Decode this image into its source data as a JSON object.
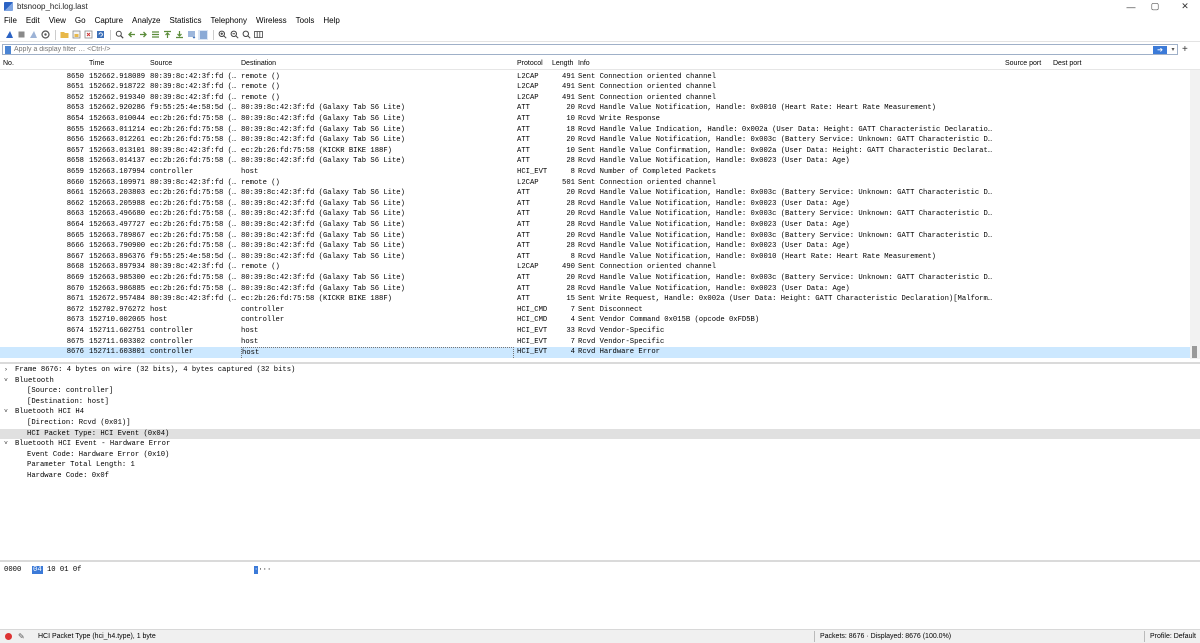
{
  "window": {
    "title": "btsnoop_hci.log.last",
    "minimize": "—",
    "maximize": "▢",
    "close": "✕"
  },
  "menu": [
    "File",
    "Edit",
    "View",
    "Go",
    "Capture",
    "Analyze",
    "Statistics",
    "Telephony",
    "Wireless",
    "Tools",
    "Help"
  ],
  "toolbar_icons": [
    "shark-fin-start-icon",
    "stop-icon",
    "restart-icon",
    "capture-options-icon",
    "open-file-icon",
    "save-file-icon",
    "close-file-icon",
    "reload-icon",
    "find-packet-icon",
    "go-back-icon",
    "go-forward-icon",
    "go-to-packet-icon",
    "go-first-icon",
    "go-last-icon",
    "auto-scroll-icon",
    "colorize-icon",
    "zoom-in-icon",
    "zoom-out-icon",
    "zoom-normal-icon",
    "resize-columns-icon"
  ],
  "filter": {
    "placeholder": "Apply a display filter … <Ctrl-/>",
    "apply_symbol": "➔",
    "dropdown_symbol": "▾",
    "add_symbol": "+"
  },
  "packet_list": {
    "columns": [
      "No.",
      "Time",
      "Source",
      "Destination",
      "Protocol",
      "Length",
      "Info",
      "Source port",
      "Dest port"
    ],
    "rows": [
      {
        "no": "8650",
        "time": "152662.918089",
        "src": "80:39:8c:42:3f:fd (…",
        "dst": "remote ()",
        "proto": "L2CAP",
        "len": "491",
        "info": "Sent Connection oriented channel"
      },
      {
        "no": "8651",
        "time": "152662.918722",
        "src": "80:39:8c:42:3f:fd (…",
        "dst": "remote ()",
        "proto": "L2CAP",
        "len": "491",
        "info": "Sent Connection oriented channel"
      },
      {
        "no": "8652",
        "time": "152662.919340",
        "src": "80:39:8c:42:3f:fd (…",
        "dst": "remote ()",
        "proto": "L2CAP",
        "len": "491",
        "info": "Sent Connection oriented channel"
      },
      {
        "no": "8653",
        "time": "152662.920286",
        "src": "f9:55:25:4e:58:5d (…",
        "dst": "80:39:8c:42:3f:fd (Galaxy Tab S6 Lite)",
        "proto": "ATT",
        "len": "20",
        "info": "Rcvd Handle Value Notification, Handle: 0x0010 (Heart Rate: Heart Rate Measurement)"
      },
      {
        "no": "8654",
        "time": "152663.010044",
        "src": "ec:2b:26:fd:75:58 (…",
        "dst": "80:39:8c:42:3f:fd (Galaxy Tab S6 Lite)",
        "proto": "ATT",
        "len": "10",
        "info": "Rcvd Write Response"
      },
      {
        "no": "8655",
        "time": "152663.011214",
        "src": "ec:2b:26:fd:75:58 (…",
        "dst": "80:39:8c:42:3f:fd (Galaxy Tab S6 Lite)",
        "proto": "ATT",
        "len": "18",
        "info": "Rcvd Handle Value Indication, Handle: 0x002a (User Data: Height: GATT Characteristic Declaratio…"
      },
      {
        "no": "8656",
        "time": "152663.012261",
        "src": "ec:2b:26:fd:75:58 (…",
        "dst": "80:39:8c:42:3f:fd (Galaxy Tab S6 Lite)",
        "proto": "ATT",
        "len": "20",
        "info": "Rcvd Handle Value Notification, Handle: 0x003c (Battery Service: Unknown: GATT Characteristic D…"
      },
      {
        "no": "8657",
        "time": "152663.013101",
        "src": "80:39:8c:42:3f:fd (…",
        "dst": "ec:2b:26:fd:75:58 (KICKR BIKE 188F)",
        "proto": "ATT",
        "len": "10",
        "info": "Sent Handle Value Confirmation, Handle: 0x002a (User Data: Height: GATT Characteristic Declarat…"
      },
      {
        "no": "8658",
        "time": "152663.014137",
        "src": "ec:2b:26:fd:75:58 (…",
        "dst": "80:39:8c:42:3f:fd (Galaxy Tab S6 Lite)",
        "proto": "ATT",
        "len": "28",
        "info": "Rcvd Handle Value Notification, Handle: 0x0023 (User Data: Age)"
      },
      {
        "no": "8659",
        "time": "152663.107994",
        "src": "controller",
        "dst": "host",
        "proto": "HCI_EVT",
        "len": "8",
        "info": "Rcvd Number of Completed Packets"
      },
      {
        "no": "8660",
        "time": "152663.109971",
        "src": "80:39:8c:42:3f:fd (…",
        "dst": "remote ()",
        "proto": "L2CAP",
        "len": "501",
        "info": "Sent Connection oriented channel"
      },
      {
        "no": "8661",
        "time": "152663.203803",
        "src": "ec:2b:26:fd:75:58 (…",
        "dst": "80:39:8c:42:3f:fd (Galaxy Tab S6 Lite)",
        "proto": "ATT",
        "len": "20",
        "info": "Rcvd Handle Value Notification, Handle: 0x003c (Battery Service: Unknown: GATT Characteristic D…"
      },
      {
        "no": "8662",
        "time": "152663.205988",
        "src": "ec:2b:26:fd:75:58 (…",
        "dst": "80:39:8c:42:3f:fd (Galaxy Tab S6 Lite)",
        "proto": "ATT",
        "len": "28",
        "info": "Rcvd Handle Value Notification, Handle: 0x0023 (User Data: Age)"
      },
      {
        "no": "8663",
        "time": "152663.496680",
        "src": "ec:2b:26:fd:75:58 (…",
        "dst": "80:39:8c:42:3f:fd (Galaxy Tab S6 Lite)",
        "proto": "ATT",
        "len": "20",
        "info": "Rcvd Handle Value Notification, Handle: 0x003c (Battery Service: Unknown: GATT Characteristic D…"
      },
      {
        "no": "8664",
        "time": "152663.497727",
        "src": "ec:2b:26:fd:75:58 (…",
        "dst": "80:39:8c:42:3f:fd (Galaxy Tab S6 Lite)",
        "proto": "ATT",
        "len": "28",
        "info": "Rcvd Handle Value Notification, Handle: 0x0023 (User Data: Age)"
      },
      {
        "no": "8665",
        "time": "152663.789867",
        "src": "ec:2b:26:fd:75:58 (…",
        "dst": "80:39:8c:42:3f:fd (Galaxy Tab S6 Lite)",
        "proto": "ATT",
        "len": "20",
        "info": "Rcvd Handle Value Notification, Handle: 0x003c (Battery Service: Unknown: GATT Characteristic D…"
      },
      {
        "no": "8666",
        "time": "152663.790900",
        "src": "ec:2b:26:fd:75:58 (…",
        "dst": "80:39:8c:42:3f:fd (Galaxy Tab S6 Lite)",
        "proto": "ATT",
        "len": "28",
        "info": "Rcvd Handle Value Notification, Handle: 0x0023 (User Data: Age)"
      },
      {
        "no": "8667",
        "time": "152663.896376",
        "src": "f9:55:25:4e:58:5d (…",
        "dst": "80:39:8c:42:3f:fd (Galaxy Tab S6 Lite)",
        "proto": "ATT",
        "len": "8",
        "info": "Rcvd Handle Value Notification, Handle: 0x0010 (Heart Rate: Heart Rate Measurement)"
      },
      {
        "no": "8668",
        "time": "152663.897934",
        "src": "80:39:8c:42:3f:fd (…",
        "dst": "remote ()",
        "proto": "L2CAP",
        "len": "490",
        "info": "Sent Connection oriented channel"
      },
      {
        "no": "8669",
        "time": "152663.985300",
        "src": "ec:2b:26:fd:75:58 (…",
        "dst": "80:39:8c:42:3f:fd (Galaxy Tab S6 Lite)",
        "proto": "ATT",
        "len": "20",
        "info": "Rcvd Handle Value Notification, Handle: 0x003c (Battery Service: Unknown: GATT Characteristic D…"
      },
      {
        "no": "8670",
        "time": "152663.986885",
        "src": "ec:2b:26:fd:75:58 (…",
        "dst": "80:39:8c:42:3f:fd (Galaxy Tab S6 Lite)",
        "proto": "ATT",
        "len": "28",
        "info": "Rcvd Handle Value Notification, Handle: 0x0023 (User Data: Age)"
      },
      {
        "no": "8671",
        "time": "152672.957484",
        "src": "80:39:8c:42:3f:fd (…",
        "dst": "ec:2b:26:fd:75:58 (KICKR BIKE 188F)",
        "proto": "ATT",
        "len": "15",
        "info": "Sent Write Request, Handle: 0x002a (User Data: Height: GATT Characteristic Declaration)[Malform…"
      },
      {
        "no": "8672",
        "time": "152702.976272",
        "src": "host",
        "dst": "controller",
        "proto": "HCI_CMD",
        "len": "7",
        "info": "Sent Disconnect"
      },
      {
        "no": "8673",
        "time": "152710.002065",
        "src": "host",
        "dst": "controller",
        "proto": "HCI_CMD",
        "len": "4",
        "info": "Sent Vendor Command 0x015B (opcode 0xFD5B)"
      },
      {
        "no": "8674",
        "time": "152711.602751",
        "src": "controller",
        "dst": "host",
        "proto": "HCI_EVT",
        "len": "33",
        "info": "Rcvd Vendor-Specific"
      },
      {
        "no": "8675",
        "time": "152711.603302",
        "src": "controller",
        "dst": "host",
        "proto": "HCI_EVT",
        "len": "7",
        "info": "Rcvd Vendor-Specific"
      },
      {
        "no": "8676",
        "time": "152711.603801",
        "src": "controller",
        "dst": "host",
        "proto": "HCI_EVT",
        "len": "4",
        "info": "Rcvd Hardware Error"
      }
    ]
  },
  "details": {
    "rows": [
      {
        "arrow": "›",
        "text": "Frame 8676: 4 bytes on wire (32 bits), 4 bytes captured (32 bits)"
      },
      {
        "arrow": "˅",
        "text": "Bluetooth"
      },
      {
        "arrow": "",
        "text": "[Source: controller]"
      },
      {
        "arrow": "",
        "text": "[Destination: host]"
      },
      {
        "arrow": "˅",
        "text": "Bluetooth HCI H4"
      },
      {
        "arrow": "",
        "text": "[Direction: Rcvd (0x01)]"
      },
      {
        "arrow": "",
        "text": "HCI Packet Type: HCI Event (0x04)"
      },
      {
        "arrow": "˅",
        "text": "Bluetooth HCI Event - Hardware Error"
      },
      {
        "arrow": "",
        "text": "Event Code: Hardware Error (0x10)"
      },
      {
        "arrow": "",
        "text": "Parameter Total Length: 1"
      },
      {
        "arrow": "",
        "text": "Hardware Code: 0x0f"
      }
    ]
  },
  "bytes": {
    "offset": "0000",
    "hex_selected": "04",
    "hex_rest": "10 01 0f",
    "ascii_selected": "·",
    "ascii_rest": "···"
  },
  "status": {
    "field_info": "HCI Packet Type (hci_h4.type), 1 byte",
    "packets": "Packets: 8676 · Displayed: 8676 (100.0%)",
    "profile": "Profile: Default"
  },
  "colors": {
    "selected_row": "#cce8ff",
    "highlight_detail": "#e0e0e0",
    "accent": "#3b7ad8"
  }
}
